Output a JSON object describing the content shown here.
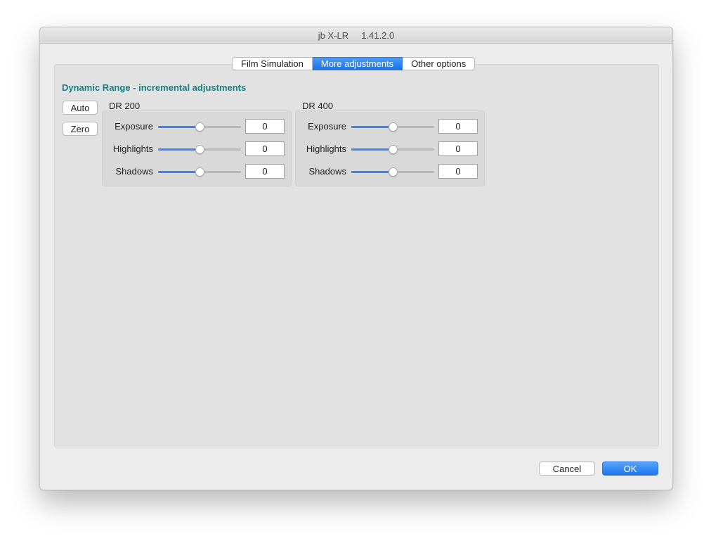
{
  "window": {
    "title": "jb X-LR     1.41.2.0"
  },
  "tabs": [
    {
      "label": "Film Simulation",
      "active": false
    },
    {
      "label": "More adjustments",
      "active": true
    },
    {
      "label": "Other options",
      "active": false
    }
  ],
  "section": {
    "title": "Dynamic Range - incremental adjustments",
    "buttons": {
      "auto": "Auto",
      "zero": "Zero"
    }
  },
  "groups": [
    {
      "label": "DR 200",
      "rows": [
        {
          "label": "Exposure",
          "value": "0",
          "slider_fraction": 0.5
        },
        {
          "label": "Highlights",
          "value": "0",
          "slider_fraction": 0.5
        },
        {
          "label": "Shadows",
          "value": "0",
          "slider_fraction": 0.5
        }
      ]
    },
    {
      "label": "DR 400",
      "rows": [
        {
          "label": "Exposure",
          "value": "0",
          "slider_fraction": 0.5
        },
        {
          "label": "Highlights",
          "value": "0",
          "slider_fraction": 0.5
        },
        {
          "label": "Shadows",
          "value": "0",
          "slider_fraction": 0.5
        }
      ]
    }
  ],
  "footer": {
    "cancel_label": "Cancel",
    "ok_label": "OK"
  },
  "colors": {
    "accent": "#1a73e8",
    "section_title": "#1a7d80"
  }
}
